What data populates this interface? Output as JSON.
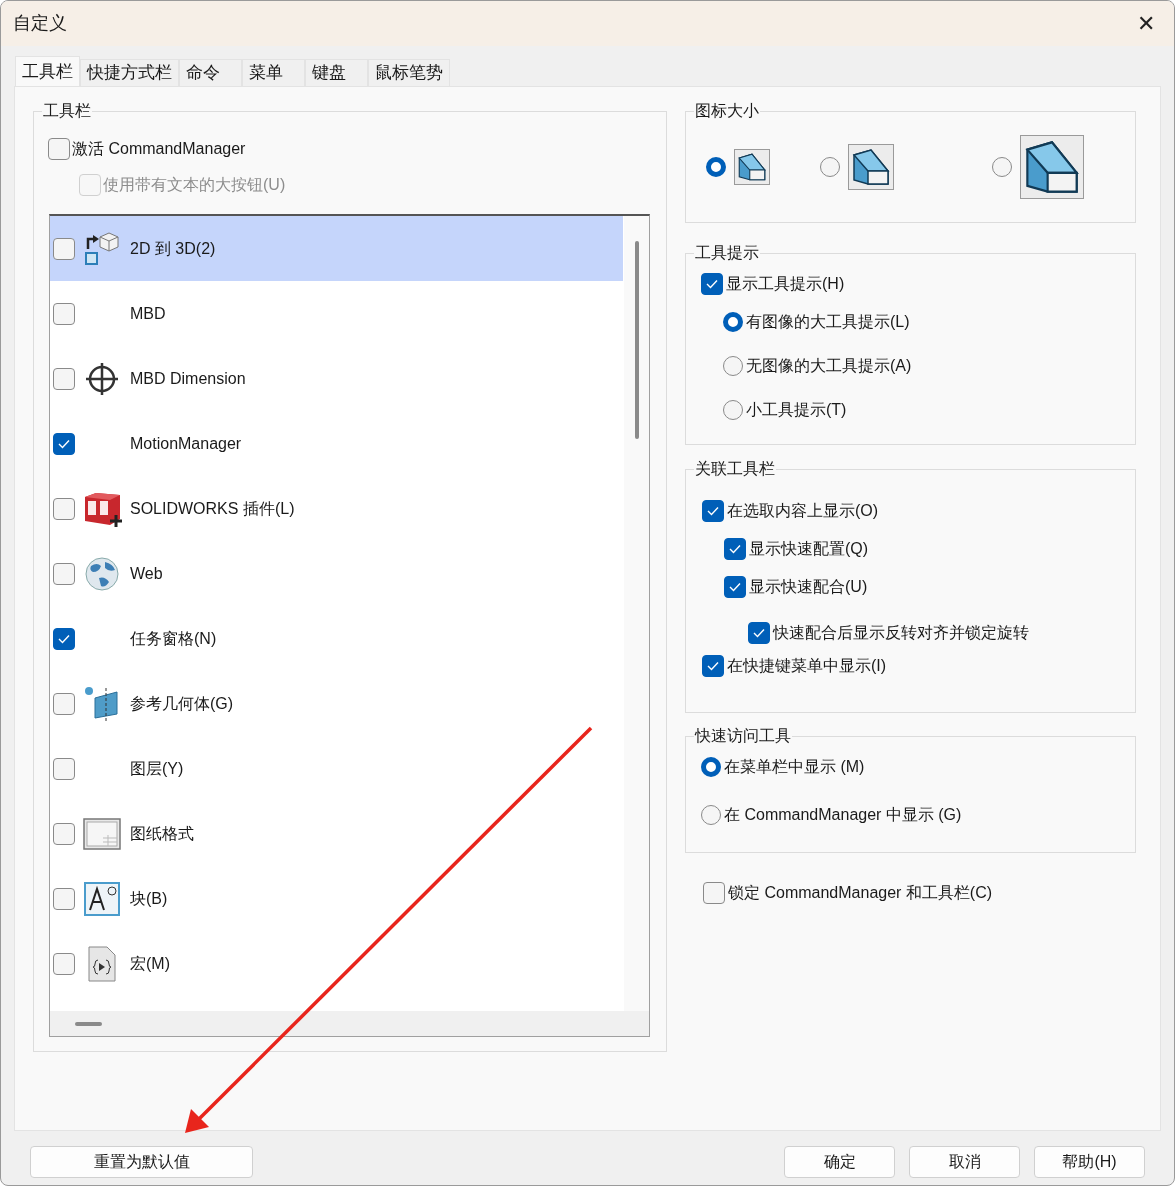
{
  "window": {
    "title": "自定义",
    "close": "✕"
  },
  "tabs": [
    {
      "label": "工具栏",
      "selected": true
    },
    {
      "label": "快捷方式栏",
      "selected": false
    },
    {
      "label": "命令",
      "selected": false
    },
    {
      "label": "菜单",
      "selected": false
    },
    {
      "label": "键盘",
      "selected": false
    },
    {
      "label": "鼠标笔势",
      "selected": false
    }
  ],
  "toolbars": {
    "title": "工具栏",
    "activate": {
      "label": "激活 CommandManager",
      "checked": false
    },
    "large_buttons": {
      "label": "使用带有文本的大按钮(U)",
      "checked": false,
      "disabled": true
    },
    "items": [
      {
        "label": "2D 到 3D(2)",
        "checked": false,
        "selected": true,
        "kind": "convert"
      },
      {
        "label": "MBD",
        "checked": false,
        "selected": false
      },
      {
        "label": "MBD Dimension",
        "checked": false,
        "selected": false,
        "kind": "crosshair"
      },
      {
        "label": "MotionManager",
        "checked": true,
        "selected": false
      },
      {
        "label": "SOLIDWORKS 插件(L)",
        "checked": false,
        "selected": false,
        "kind": "addin"
      },
      {
        "label": "Web",
        "checked": false,
        "selected": false,
        "kind": "globe"
      },
      {
        "label": "任务窗格(N)",
        "checked": true,
        "selected": false
      },
      {
        "label": "参考几何体(G)",
        "checked": false,
        "selected": false,
        "kind": "plane"
      },
      {
        "label": "图层(Y)",
        "checked": false,
        "selected": false
      },
      {
        "label": "图纸格式",
        "checked": false,
        "selected": false,
        "kind": "sheet"
      },
      {
        "label": "块(B)",
        "checked": false,
        "selected": false,
        "kind": "block"
      },
      {
        "label": "宏(M)",
        "checked": false,
        "selected": false,
        "kind": "macro"
      }
    ]
  },
  "icon_size": {
    "title": "图标大小",
    "options": [
      {
        "selected": true
      },
      {
        "selected": false
      },
      {
        "selected": false
      }
    ]
  },
  "tooltips": {
    "title": "工具提示",
    "show": {
      "label": "显示工具提示(H)",
      "checked": true
    },
    "styles": [
      {
        "label": "有图像的大工具提示(L)",
        "selected": true
      },
      {
        "label": "无图像的大工具提示(A)",
        "selected": false
      },
      {
        "label": "小工具提示(T)",
        "selected": false
      }
    ]
  },
  "context_toolbars": {
    "title": "关联工具栏",
    "items": [
      {
        "label": "在选取内容上显示(O)",
        "checked": true,
        "children": [
          {
            "label": "显示快速配置(Q)",
            "checked": true
          },
          {
            "label": "显示快速配合(U)",
            "checked": true,
            "children": [
              {
                "label": "快速配合后显示反转对齐并锁定旋转",
                "checked": true
              }
            ]
          }
        ]
      },
      {
        "label": "在快捷键菜单中显示(I)",
        "checked": true
      }
    ]
  },
  "quick_access": {
    "title": "快速访问工具",
    "options": [
      {
        "label": "在菜单栏中显示 (M)",
        "selected": true
      },
      {
        "label": "在 CommandManager 中显示 (G)",
        "selected": false
      }
    ]
  },
  "lock": {
    "label": "锁定 CommandManager 和工具栏(C)",
    "checked": false
  },
  "buttons": {
    "reset": "重置为默认值",
    "actions": [
      "确定",
      "取消",
      "帮助(H)"
    ]
  }
}
